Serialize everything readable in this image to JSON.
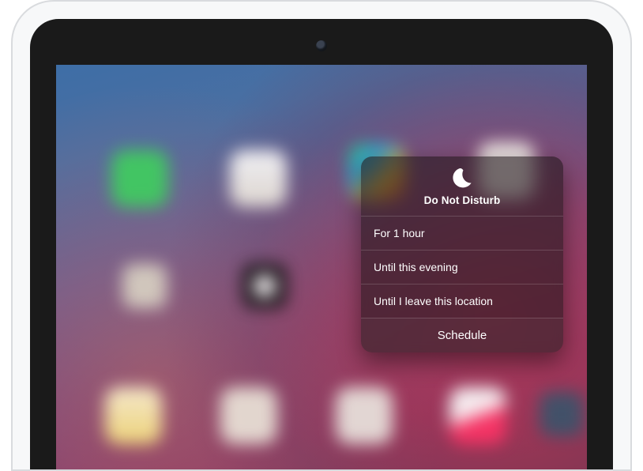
{
  "dnd_popover": {
    "title": "Do Not Disturb",
    "options": [
      "For 1 hour",
      "Until this evening",
      "Until I leave this location"
    ],
    "schedule_label": "Schedule"
  }
}
